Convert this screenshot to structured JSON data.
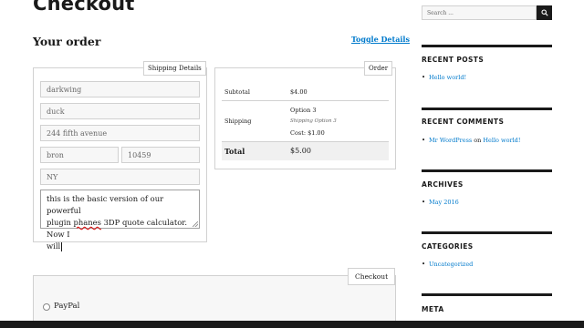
{
  "page": {
    "title": "Checkout"
  },
  "order": {
    "heading": "Your order",
    "toggle_label": "Toggle Details"
  },
  "shipping": {
    "legend": "Shipping Details",
    "first_name": "darkwing",
    "last_name": "duck",
    "address": "244 fifth avenue",
    "city": "bron",
    "zip": "10459",
    "state": "NY",
    "notes_line1": "this is the basic version of our powerful",
    "notes_line2_pre": "plugin ",
    "notes_line2_misspelled": "phanes",
    "notes_line2_post": " 3DP quote calculator. Now I",
    "notes_line3": "will"
  },
  "order_summary": {
    "legend": "Order",
    "subtotal_label": "Subtotal",
    "subtotal_value": "$4.00",
    "shipping_label": "Shipping",
    "shipping_option": "Option 3",
    "shipping_option_detail": "Shipping Option 3",
    "shipping_cost": "Cost: $1.00",
    "total_label": "Total",
    "total_value": "$5.00"
  },
  "checkout": {
    "legend": "Checkout",
    "paypal_label": "PayPal"
  },
  "sidebar": {
    "search_placeholder": "Search ...",
    "recent_posts": {
      "title": "RECENT POSTS",
      "items": [
        "Hello world!"
      ]
    },
    "recent_comments": {
      "title": "RECENT COMMENTS",
      "author": "Mr WordPress",
      "on": "on",
      "post": "Hello world!"
    },
    "archives": {
      "title": "ARCHIVES",
      "items": [
        "May 2016"
      ]
    },
    "categories": {
      "title": "CATEGORIES",
      "items": [
        "Uncategorized"
      ]
    },
    "meta": {
      "title": "META"
    }
  },
  "colors": {
    "link": "#007acc",
    "border": "#d1d1d1",
    "dark": "#1a1a1a",
    "input_bg": "#f7f7f7"
  }
}
